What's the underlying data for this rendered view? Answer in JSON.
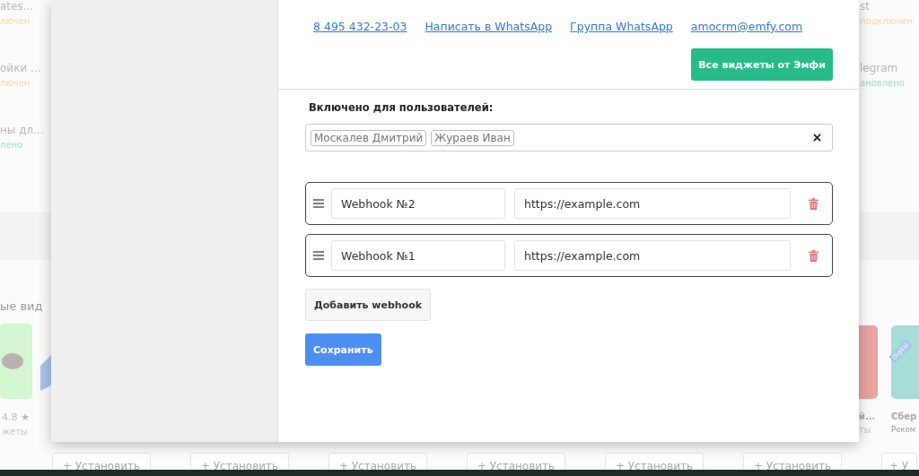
{
  "background": {
    "left_items": [
      {
        "title": "ates...",
        "status": "лючен",
        "kind": "off"
      },
      {
        "title": "ойки ...",
        "status": "лючен",
        "kind": "off"
      },
      {
        "title": "ны дл...",
        "status": "лено",
        "kind": "on"
      }
    ],
    "right_items": [
      {
        "title": "st",
        "status": "подключен",
        "kind": "off"
      },
      {
        "title": "legram",
        "status": "ановлено",
        "kind": "on"
      }
    ],
    "section_title": "ые вид",
    "left_card": {
      "rating": "4.8 ★",
      "category": "жеты"
    },
    "right_cards": [
      {
        "title": "й...",
        "category": "ты",
        "color": "#eaa3a0"
      },
      {
        "title": "Сбер",
        "category": "Реком",
        "color": "#a6ddd6",
        "ribbon": "Digital"
      }
    ],
    "install_buttons": [
      "+ Установить",
      "+ Установить",
      "+ Установить",
      "+ Установить",
      "+ Установить",
      "+ Установить",
      "+ У"
    ]
  },
  "modal": {
    "links": [
      "8 495 432-23-03",
      "Написать в WhatsApp",
      "Группа WhatsApp",
      "amocrm@emfy.com"
    ],
    "all_widgets_button": "Все виджеты от Эмфи",
    "users_label": "Включено для пользователей:",
    "users": [
      "Москалев Дмитрий",
      "Жураев Иван"
    ],
    "webhooks": [
      {
        "name": "Webhook №2",
        "url": "https://example.com"
      },
      {
        "name": "Webhook №1",
        "url": "https://example.com"
      }
    ],
    "add_button": "Добавить webhook",
    "save_button": "Сохранить"
  }
}
